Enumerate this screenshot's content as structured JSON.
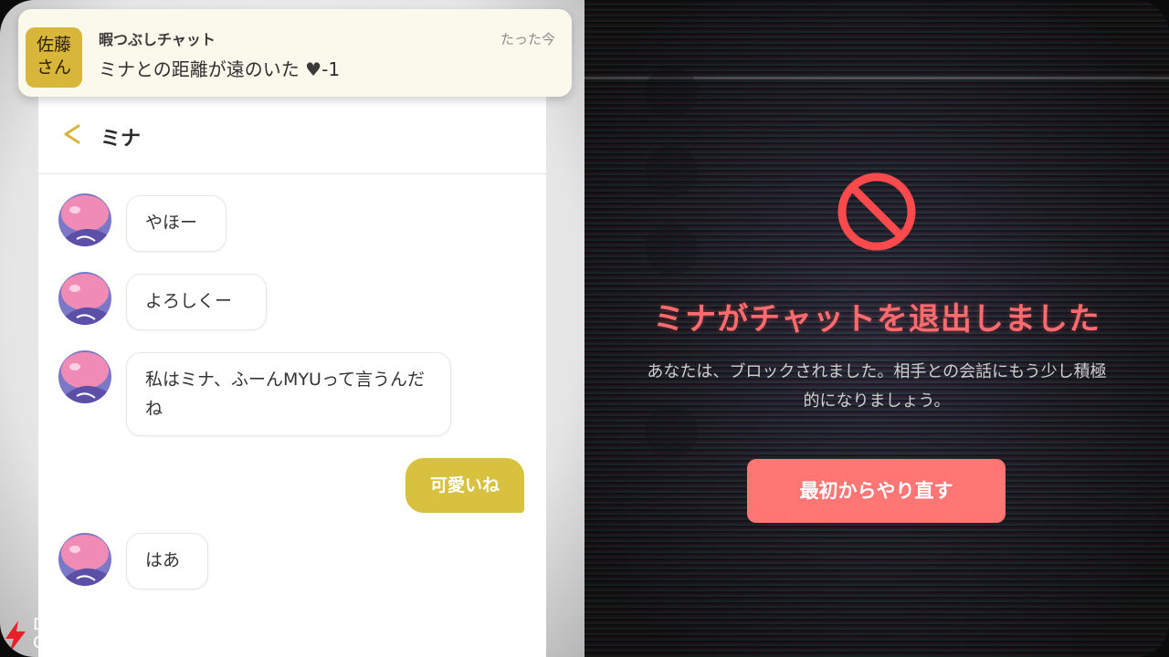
{
  "notification": {
    "sender_avatar_text": "佐藤\nさん",
    "app_name": "暇つぶしチャット",
    "time": "たった今",
    "message": "ミナとの距離が遠のいた",
    "heart_icon": "heart-icon",
    "heart_change": "-1"
  },
  "chat": {
    "title": "ミナ",
    "back_icon": "chevron-left-icon",
    "accent_color": "#d7c13e",
    "messages": [
      {
        "from": "ミナ",
        "text": "やほー"
      },
      {
        "from": "ミナ",
        "text": "よろしくー"
      },
      {
        "from": "ミナ",
        "text": "私はミナ、ふーんMYUって言うんだね"
      },
      {
        "from": "me",
        "text": "可愛いね"
      },
      {
        "from": "ミナ",
        "text": "はあ"
      }
    ]
  },
  "overlay": {
    "icon": "prohibited-icon",
    "title": "ミナがチャットを退出しました",
    "description": "あなたは、ブロックされました。相手との会話にもう少し積極的になりましょう。",
    "restart_button": "最初からやり直す",
    "title_color": "#ff6b6e",
    "button_color": "#ff7674"
  },
  "watermark": {
    "line1": "DENGEKI",
    "line2": "ONLINE"
  }
}
